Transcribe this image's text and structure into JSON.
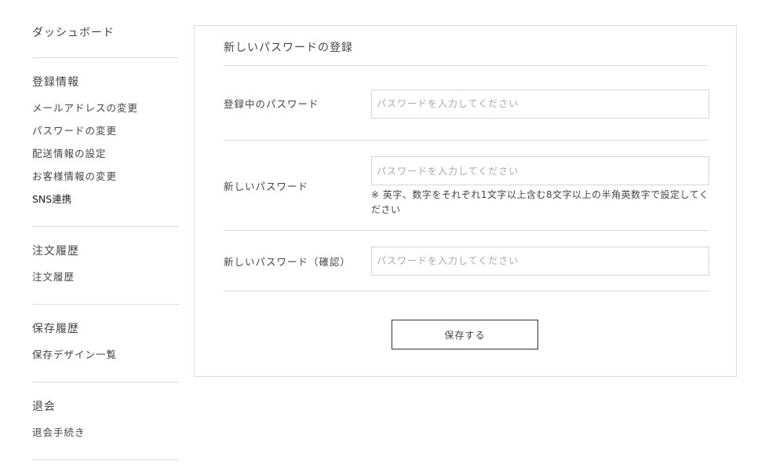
{
  "sidebar": {
    "dashboard": "ダッシュボード",
    "sections": [
      {
        "heading": "登録情報",
        "links": [
          "メールアドレスの変更",
          "パスワードの変更",
          "配送情報の設定",
          "お客様情報の変更",
          "SNS連携"
        ]
      },
      {
        "heading": "注文履歴",
        "links": [
          "注文履歴"
        ]
      },
      {
        "heading": "保存履歴",
        "links": [
          "保存デザイン一覧"
        ]
      },
      {
        "heading": "退会",
        "links": [
          "退会手続き"
        ]
      }
    ]
  },
  "main": {
    "title": "新しいパスワードの登録",
    "fields": [
      {
        "label": "登録中のパスワード",
        "placeholder": "パスワードを入力してください",
        "value": ""
      },
      {
        "label": "新しいパスワード",
        "placeholder": "パスワードを入力してください",
        "value": "",
        "hint": "※ 英字、数字をそれぞれ1文字以上含む8文字以上の半角英数字で設定してください"
      },
      {
        "label": "新しいパスワード（確認）",
        "placeholder": "パスワードを入力してください",
        "value": ""
      }
    ],
    "save_label": "保存する"
  }
}
